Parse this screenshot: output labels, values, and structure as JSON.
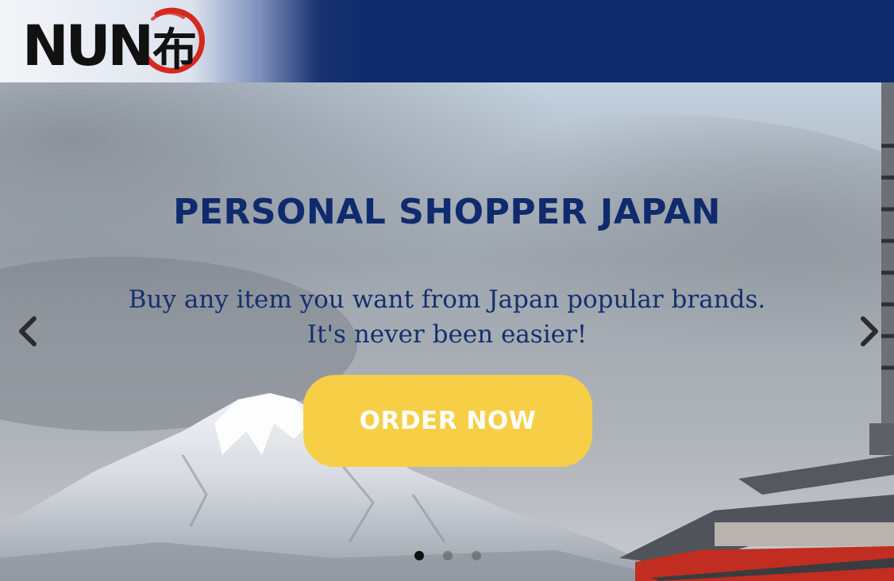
{
  "header": {
    "logo_text": "NUN",
    "logo_kanji": "布",
    "background_color": "#0d2b6b"
  },
  "hero": {
    "title": "PERSONAL SHOPPER JAPAN",
    "subtitle_line1": "Buy any item you want from Japan popular brands.",
    "subtitle_line2": "It's never been easier!",
    "cta_label": "ORDER NOW",
    "cta_color": "#f6cf47",
    "title_color": "#0f2b6d",
    "prev_icon": "chevron-left-icon",
    "next_icon": "chevron-right-icon",
    "slides_total": 3,
    "active_slide": 1
  }
}
